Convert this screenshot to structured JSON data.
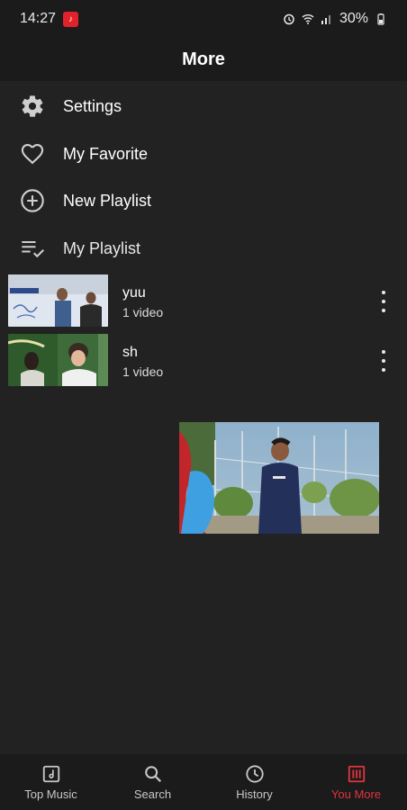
{
  "status_bar": {
    "time": "14:27",
    "battery": "30%"
  },
  "app_bar": {
    "title": "More"
  },
  "menu": [
    {
      "label": "Settings",
      "icon": "gear-icon"
    },
    {
      "label": "My Favorite",
      "icon": "heart-icon"
    },
    {
      "label": "New Playlist",
      "icon": "plus-circle-icon"
    },
    {
      "label": "My Playlist",
      "icon": "playlist-check-icon"
    }
  ],
  "playlists": [
    {
      "name": "yuu",
      "count": "1 video"
    },
    {
      "name": "sh",
      "count": "1 video"
    }
  ],
  "bottom_nav": [
    {
      "label": "Top Music",
      "icon": "music-note-icon"
    },
    {
      "label": "Search",
      "icon": "search-icon"
    },
    {
      "label": "History",
      "icon": "clock-icon"
    },
    {
      "label": "You More",
      "icon": "grid-icon",
      "active": true
    }
  ],
  "colors": {
    "background": "#222222",
    "bar": "#1b1b1b",
    "accent": "#e0343f"
  }
}
